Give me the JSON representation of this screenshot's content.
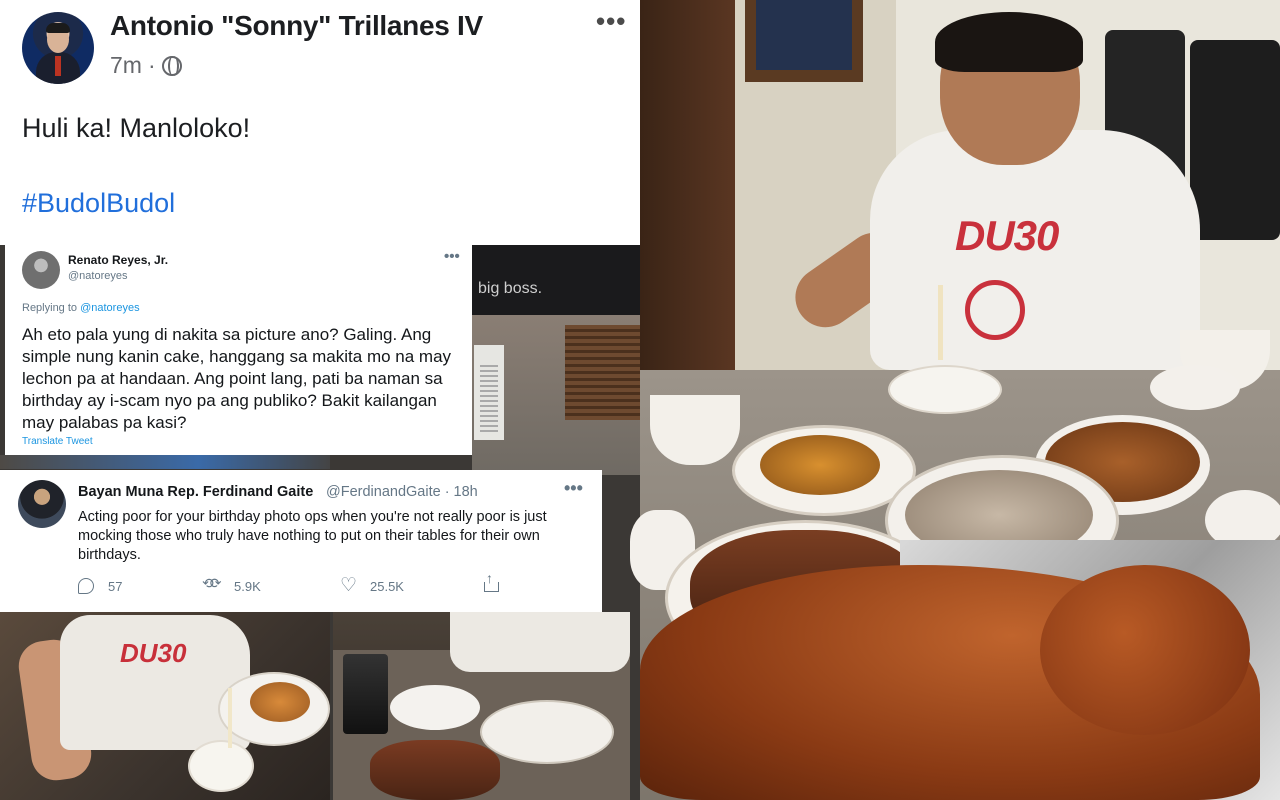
{
  "facebook_post": {
    "author": "Antonio \"Sonny\" Trillanes IV",
    "time": "7m",
    "separator": "·",
    "more": "•••",
    "text": "Huli ka! Manloloko!",
    "hashtag": "#BudolBudol"
  },
  "video_caption": "big boss.",
  "tweet_1": {
    "author": "Renato Reyes, Jr.",
    "handle": "@natoreyes",
    "more": "•••",
    "replying_prefix": "Replying to ",
    "replying_to": "@natoreyes",
    "body": "Ah eto pala yung di nakita sa picture ano? Galing. Ang simple nung kanin cake, hanggang sa makita mo na may lechon pa at handaan. Ang point lang, pati ba naman sa birthday ay i-scam nyo pa ang publiko? Bakit kailangan may palabas pa kasi?",
    "translate": "Translate Tweet"
  },
  "tweet_2": {
    "author": "Bayan Muna Rep. Ferdinand Gaite",
    "handle_time": "@FerdinandGaite · 18h",
    "more": "•••",
    "body": "Acting poor for your birthday photo ops when you're not really poor is just mocking those who truly have nothing to put on their tables for their own birthdays.",
    "replies": "57",
    "retweets": "5.9K",
    "likes": "25.5K"
  },
  "photo_text": {
    "shirt_logo": "DU30"
  },
  "colors": {
    "facebook_link": "#216fdb",
    "twitter_link": "#1b95e0",
    "shirt_logo": "#c9313c"
  }
}
